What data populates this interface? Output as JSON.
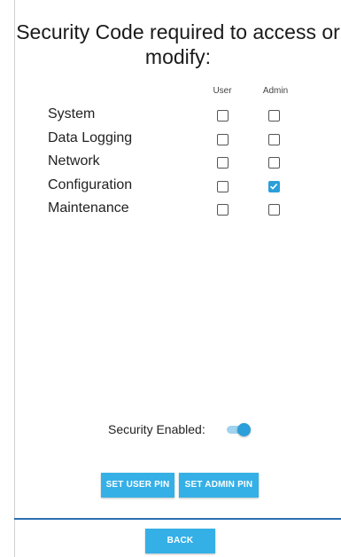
{
  "title": "Security Code required to access or modify:",
  "columns": {
    "user": "User",
    "admin": "Admin"
  },
  "rows": [
    {
      "label": "System",
      "user": false,
      "admin": false
    },
    {
      "label": "Data Logging",
      "user": false,
      "admin": false
    },
    {
      "label": "Network",
      "user": false,
      "admin": false
    },
    {
      "label": "Configuration",
      "user": false,
      "admin": true
    },
    {
      "label": "Maintenance",
      "user": false,
      "admin": false
    }
  ],
  "security": {
    "label": "Security Enabled:",
    "enabled": true
  },
  "buttons": {
    "set_user_pin": "SET USER PIN",
    "set_admin_pin": "SET ADMIN PIN",
    "back": "BACK"
  },
  "colors": {
    "accent": "#2b9fd9",
    "button": "#35b0e6",
    "divider": "#2b6fb3"
  }
}
